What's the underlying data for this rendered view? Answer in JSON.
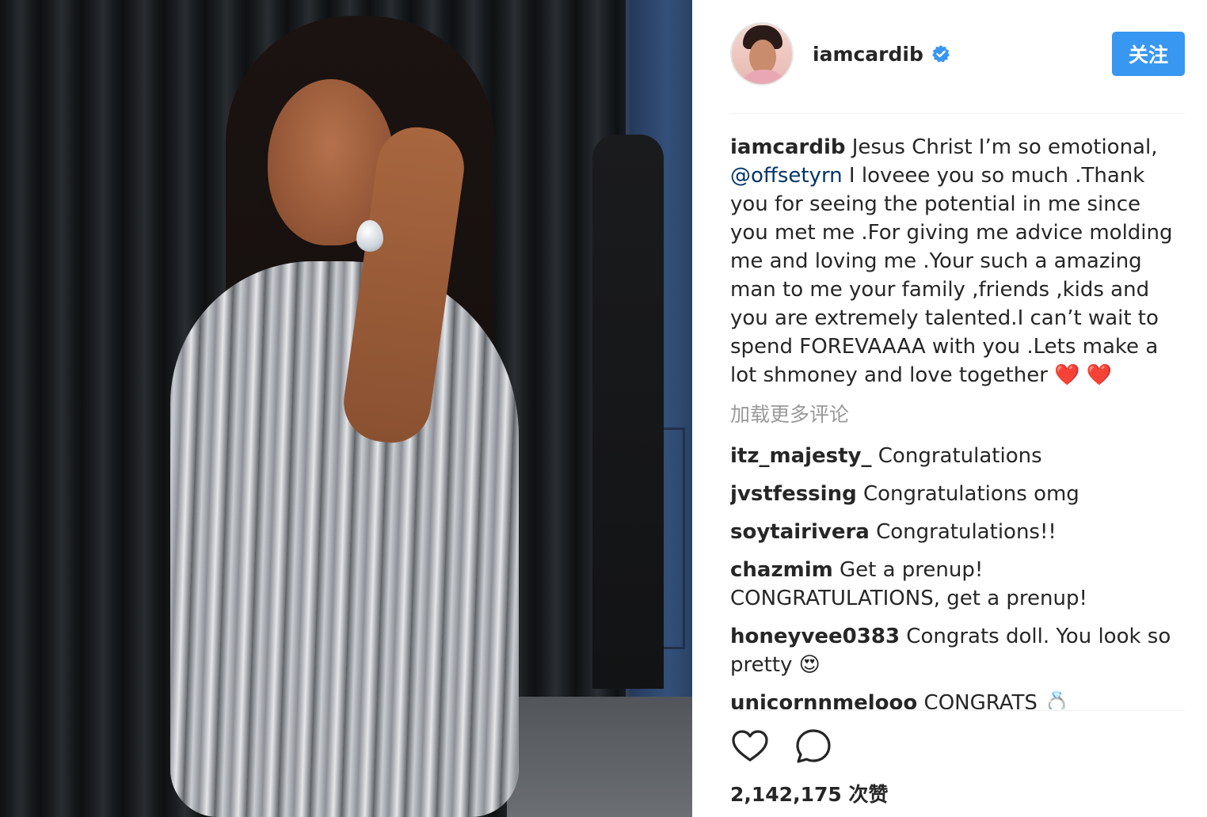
{
  "post": {
    "author": "iamcardib",
    "follow_label": "关注",
    "caption": {
      "username": "iamcardib",
      "text_before": " Jesus Christ I’m so emotional, ",
      "mention": "@offsetyrn",
      "text_after": " I loveee you so much .Thank you for seeing the potential in me since you met me .For giving me advice molding me and loving me .Your such a amazing man to me your family ,friends ,kids and you are extremely talented.I can’t wait to spend FOREVAAAA with you .Lets make a lot shmoney and love together ",
      "emoji": "❤️ ❤️"
    },
    "load_more_label": "加载更多评论",
    "comments": [
      {
        "user": "itz_majesty_",
        "text": " Congratulations"
      },
      {
        "user": "jvstfessing",
        "text": " Congratulations omg"
      },
      {
        "user": "soytairivera",
        "text": " Congratulations!!"
      },
      {
        "user": "chazmim",
        "text": " Get a prenup! CONGRATULATIONS, get a prenup!"
      },
      {
        "user": "honeyvee0383",
        "text": " Congrats doll. You look so pretty 😍"
      },
      {
        "user": "unicornnmelooo",
        "text": " CONGRATS 💍"
      }
    ],
    "likes_text": "2,142,175 次赞"
  },
  "colors": {
    "accent": "#3897f0",
    "verified": "#3897f0",
    "mention": "#003569",
    "muted": "#999999"
  },
  "icons": {
    "verified": "verified-badge-icon",
    "like": "heart-outline-icon",
    "comment": "speech-bubble-icon"
  }
}
